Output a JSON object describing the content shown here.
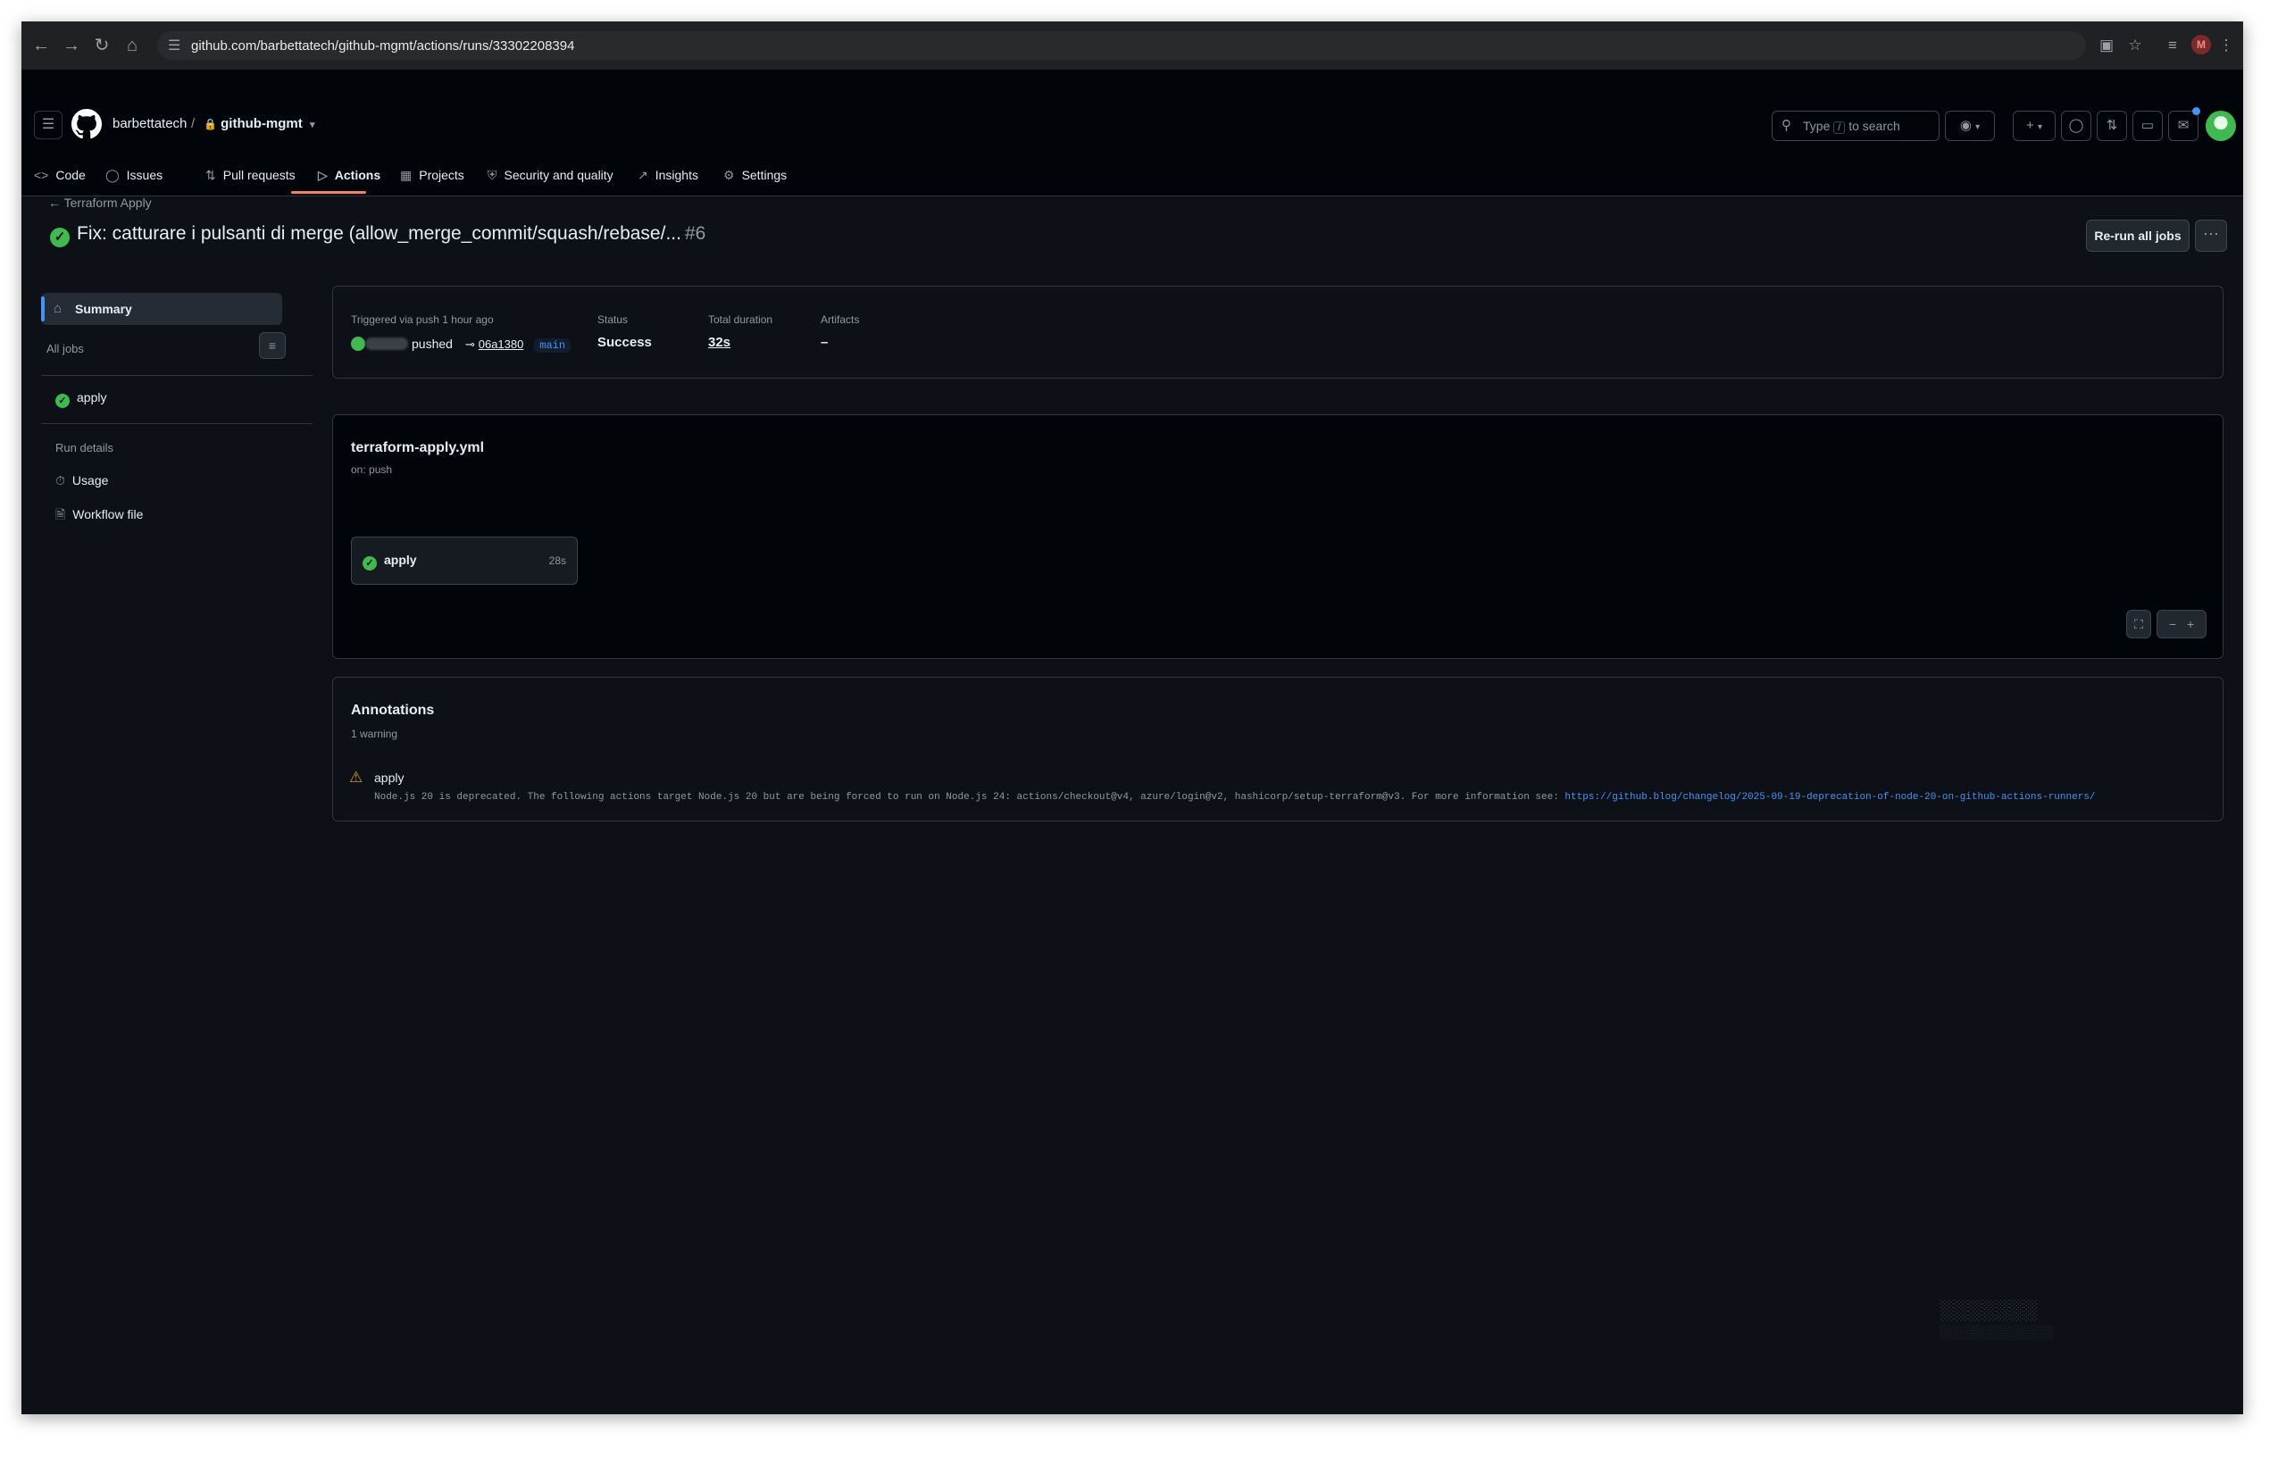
{
  "browser": {
    "url": "github.com/barbettatech/github-mgmt/actions/runs/33302208394",
    "profile_initial": "M"
  },
  "header": {
    "owner": "barbettatech",
    "separator": "/",
    "repo": "github-mgmt",
    "search_placeholder_pre": "Type",
    "search_key": "/",
    "search_placeholder_post": "to search"
  },
  "tabs": [
    {
      "label": "Code",
      "icon": "code-icon"
    },
    {
      "label": "Issues",
      "icon": "issue-icon"
    },
    {
      "label": "Pull requests",
      "icon": "pull-request-icon"
    },
    {
      "label": "Actions",
      "icon": "play-icon",
      "active": true
    },
    {
      "label": "Projects",
      "icon": "table-icon"
    },
    {
      "label": "Security and quality",
      "icon": "shield-icon"
    },
    {
      "label": "Insights",
      "icon": "graph-icon"
    },
    {
      "label": "Settings",
      "icon": "gear-icon"
    }
  ],
  "run": {
    "back_label": "Terraform Apply",
    "title": "Fix: catturare i pulsanti di merge (allow_merge_commit/squash/rebase/...",
    "number": "#6",
    "rerun_label": "Re-run all jobs"
  },
  "sidebar": {
    "summary": "Summary",
    "all_jobs": "All jobs",
    "jobs": [
      "apply"
    ],
    "run_details": "Run details",
    "usage": "Usage",
    "workflow_file": "Workflow file"
  },
  "info": {
    "trigger_label": "Triggered via push 1 hour ago",
    "actor_action": "pushed",
    "commit": "06a1380",
    "branch": "main",
    "status_label": "Status",
    "status_value": "Success",
    "duration_label": "Total duration",
    "duration_value": "32s",
    "artifacts_label": "Artifacts",
    "artifacts_value": "–"
  },
  "graph": {
    "workflow_file": "terraform-apply.yml",
    "on": "on: push",
    "job": {
      "name": "apply",
      "duration": "28s"
    }
  },
  "annotations": {
    "title": "Annotations",
    "count": "1 warning",
    "job": "apply",
    "message": "Node.js 20 is deprecated. The following actions target Node.js 20 but are being forced to run on Node.js 24: actions/checkout@v4, azure/login@v2, hashicorp/setup-terraform@v3. For more information see: ",
    "link": "https://github.blog/changelog/2025-09-19-deprecation-of-node-20-on-github-actions-runners/"
  },
  "colors": {
    "background": "#0d1117",
    "success": "#3fb950",
    "accent": "#4493f8",
    "warning": "#d29922",
    "active_tab": "#f78166"
  }
}
